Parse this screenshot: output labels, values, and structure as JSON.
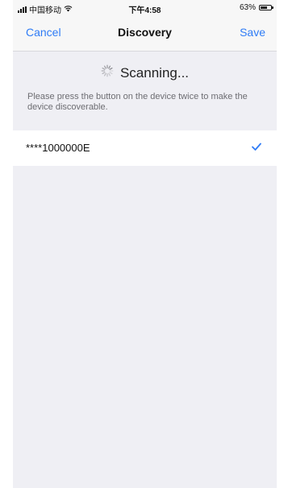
{
  "status_bar": {
    "carrier": "中国移动",
    "wifi_icon": "wifi-icon",
    "time": "下午4:58",
    "battery_percent_label": "63%",
    "battery_level": 0.63
  },
  "nav": {
    "cancel_label": "Cancel",
    "title": "Discovery",
    "save_label": "Save"
  },
  "scan": {
    "spinner_icon": "activity-spinner-icon",
    "title": "Scanning...",
    "hint": "Please press the button on the device twice to make the device discoverable."
  },
  "devices": [
    {
      "name": "****1000000E",
      "selected": true,
      "check_icon": "checkmark-icon"
    }
  ],
  "colors": {
    "accent": "#2f7cf6",
    "background": "#efeff4",
    "bar_background": "#f7f7f7"
  }
}
